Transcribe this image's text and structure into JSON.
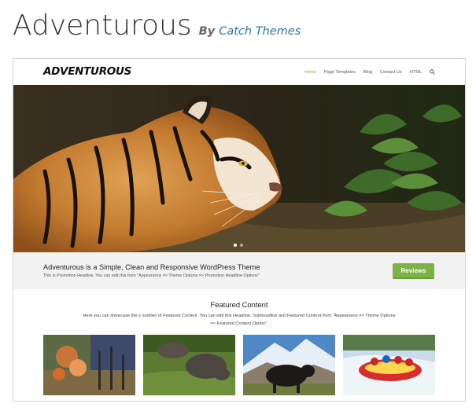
{
  "page": {
    "title": "Adventurous",
    "by_label": "By",
    "author": "Catch Themes"
  },
  "site": {
    "logo": "ADVENTUROUS",
    "nav": [
      {
        "label": "Home",
        "active": true
      },
      {
        "label": "Page Templates",
        "active": false
      },
      {
        "label": "Blog",
        "active": false
      },
      {
        "label": "Contact Us",
        "active": false
      },
      {
        "label": "HTML",
        "active": false
      }
    ],
    "search_icon": "search-icon"
  },
  "promo": {
    "headline": "Adventurous is a Simple, Clean and Responsive WordPress Theme",
    "subheadline": "This is Promotion Headine. You can edit this from \"Appearance => Theme Options => Promotion Headline Options\"",
    "button_label": "Reviews"
  },
  "featured": {
    "title": "Featured Content",
    "description": "Here you can showcase the x number of Featured Content. You can edit this Headline, Subheadline and Featured Content from \"Appearance => Theme Options => Featured Content Option\"."
  },
  "colors": {
    "accent_green": "#7cb342",
    "nav_active": "#8fb03b",
    "author_link": "#2a7ab0"
  }
}
